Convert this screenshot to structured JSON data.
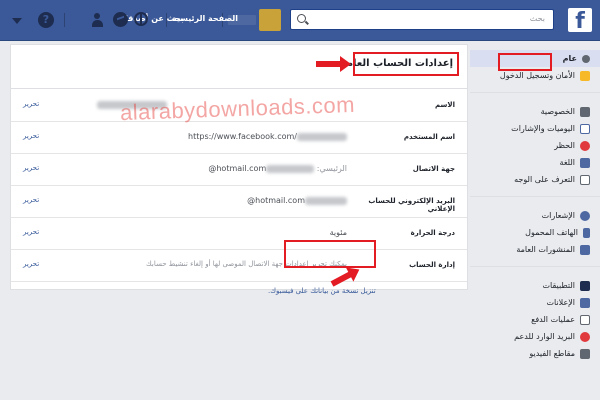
{
  "topbar": {
    "logo": "f",
    "search_placeholder": "بحث",
    "home_label": "الصفحة الرئيسية",
    "find_friends_label": "بحث عن أصدقاء",
    "help_glyph": "?"
  },
  "settings": {
    "title": "إعدادات الحساب العامة",
    "rows": [
      {
        "label": "الاسم",
        "value": "",
        "edit": "تحرير"
      },
      {
        "label": "اسم المستخدم",
        "value": "https://www.facebook.com/",
        "edit": "تحرير"
      },
      {
        "label": "جهة الاتصال",
        "value_prefix": "الرئيسي:",
        "value": "hotmail.com@",
        "edit": "تحرير"
      },
      {
        "label": "البريد الإلكتروني للحساب الإعلاني",
        "value": "hotmail.com@",
        "edit": "تحرير"
      },
      {
        "label": "درجة الحرارة",
        "value": "مئوية",
        "edit": "تحرير"
      },
      {
        "label": "إدارة الحساب",
        "value": "يمكنك تحرير إعدادات جهة الاتصال الموصى لها أو إلغاء تنشيط حسابك",
        "edit": "تحرير"
      }
    ],
    "download_link": "تنزيل نسخة من بياناتك على فيسبوك."
  },
  "sidebar": {
    "groups": [
      [
        {
          "label": "عام",
          "icon": "gear-icon",
          "color": "#606770",
          "active": true
        },
        {
          "label": "الأمان وتسجيل الدخول",
          "icon": "badge-icon",
          "color": "#f7b928"
        }
      ],
      [
        {
          "label": "الخصوصية",
          "icon": "lock-icon",
          "color": "#606770"
        },
        {
          "label": "اليوميات والإشارات",
          "icon": "timeline-icon",
          "color": "#4e69a2"
        },
        {
          "label": "الحظر",
          "icon": "block-icon",
          "color": "#e0393e"
        },
        {
          "label": "اللغة",
          "icon": "language-icon",
          "color": "#4e69a2"
        },
        {
          "label": "التعرف على الوجه",
          "icon": "face-icon",
          "color": "#606770"
        }
      ],
      [
        {
          "label": "الإشعارات",
          "icon": "globe-icon",
          "color": "#4e69a2"
        },
        {
          "label": "الهاتف المحمول",
          "icon": "phone-icon",
          "color": "#4e69a2"
        },
        {
          "label": "المنشورات العامة",
          "icon": "rss-icon",
          "color": "#4e69a2"
        }
      ],
      [
        {
          "label": "التطبيقات",
          "icon": "apps-icon",
          "color": "#1d2c4f"
        },
        {
          "label": "الإعلانات",
          "icon": "ads-icon",
          "color": "#4e69a2"
        },
        {
          "label": "عمليات الدفع",
          "icon": "payment-icon",
          "color": "#606770"
        },
        {
          "label": "البريد الوارد للدعم",
          "icon": "support-icon",
          "color": "#e0393e"
        },
        {
          "label": "مقاطع الفيديو",
          "icon": "video-icon",
          "color": "#606770"
        }
      ]
    ]
  },
  "watermark": "alarabydownloads.com"
}
